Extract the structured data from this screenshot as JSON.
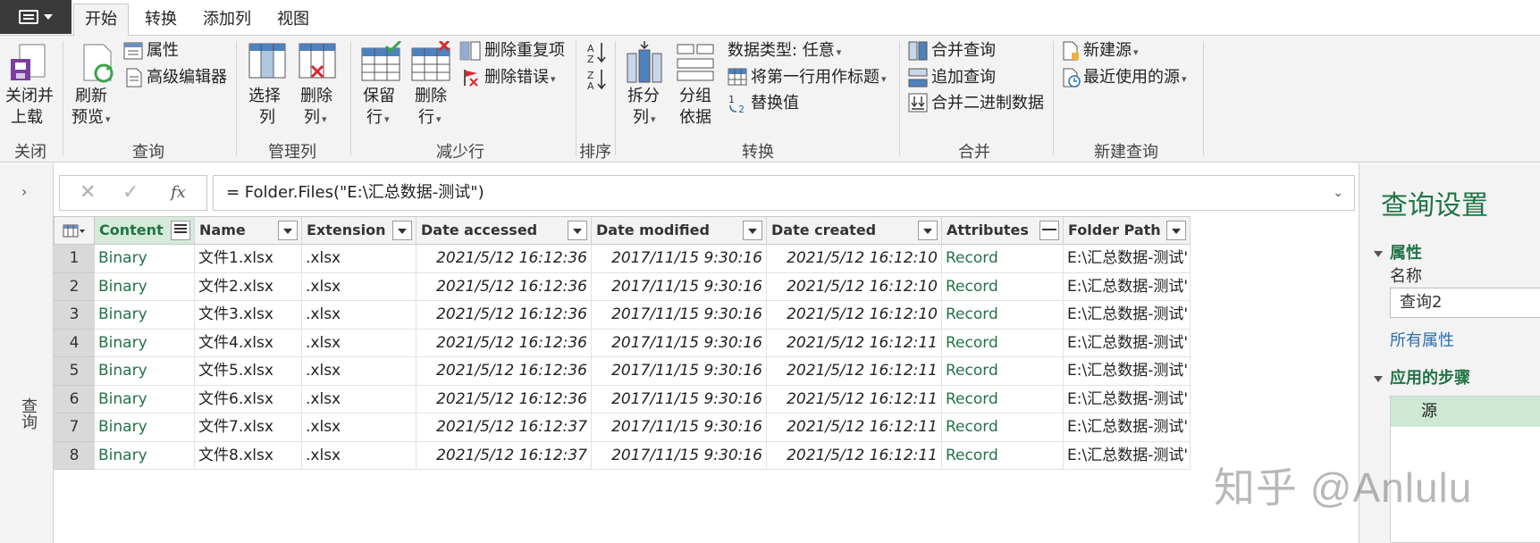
{
  "ribbon": {
    "tabs": [
      "开始",
      "转换",
      "添加列",
      "视图"
    ],
    "groups": {
      "close": {
        "label": "关闭",
        "close_load": [
          "关闭并",
          "上载"
        ]
      },
      "query": {
        "label": "查询",
        "refresh": [
          "刷新",
          "预览"
        ],
        "properties": "属性",
        "advanced_editor": "高级编辑器"
      },
      "manage_columns": {
        "label": "管理列",
        "choose": [
          "选择",
          "列"
        ],
        "remove": [
          "删除",
          "列"
        ]
      },
      "reduce_rows": {
        "label": "减少行",
        "keep": [
          "保留",
          "行"
        ],
        "remove": [
          "删除",
          "行"
        ],
        "remove_duplicates": "删除重复项",
        "remove_errors": "删除错误"
      },
      "sort": {
        "label": "排序"
      },
      "transform": {
        "label": "转换",
        "split": [
          "拆分",
          "列"
        ],
        "group": [
          "分组",
          "依据"
        ],
        "data_type": "数据类型: 任意",
        "first_row_header": "将第一行用作标题",
        "replace_values": "替换值"
      },
      "combine": {
        "label": "合并",
        "merge": "合并查询",
        "append": "追加查询",
        "combine_binary": "合并二进制数据"
      },
      "new_query": {
        "label": "新建查询",
        "new_source": "新建源",
        "recent_sources": "最近使用的源"
      }
    }
  },
  "queries_pane": {
    "label": "查询"
  },
  "formula_bar": {
    "expression": "= Folder.Files(\"E:\\汇总数据-测试\")"
  },
  "grid": {
    "columns": [
      "Content",
      "Name",
      "Extension",
      "Date accessed",
      "Date modified",
      "Date created",
      "Attributes",
      "Folder Path"
    ],
    "rows": [
      {
        "n": "1",
        "content": "Binary",
        "name": "文件1.xlsx",
        "ext": ".xlsx",
        "accessed": "2021/5/12 16:12:36",
        "modified": "2017/11/15 9:30:16",
        "created": "2021/5/12 16:12:10",
        "attributes": "Record",
        "path": "E:\\汇总数据-测试'"
      },
      {
        "n": "2",
        "content": "Binary",
        "name": "文件2.xlsx",
        "ext": ".xlsx",
        "accessed": "2021/5/12 16:12:36",
        "modified": "2017/11/15 9:30:16",
        "created": "2021/5/12 16:12:10",
        "attributes": "Record",
        "path": "E:\\汇总数据-测试'"
      },
      {
        "n": "3",
        "content": "Binary",
        "name": "文件3.xlsx",
        "ext": ".xlsx",
        "accessed": "2021/5/12 16:12:36",
        "modified": "2017/11/15 9:30:16",
        "created": "2021/5/12 16:12:10",
        "attributes": "Record",
        "path": "E:\\汇总数据-测试'"
      },
      {
        "n": "4",
        "content": "Binary",
        "name": "文件4.xlsx",
        "ext": ".xlsx",
        "accessed": "2021/5/12 16:12:36",
        "modified": "2017/11/15 9:30:16",
        "created": "2021/5/12 16:12:11",
        "attributes": "Record",
        "path": "E:\\汇总数据-测试'"
      },
      {
        "n": "5",
        "content": "Binary",
        "name": "文件5.xlsx",
        "ext": ".xlsx",
        "accessed": "2021/5/12 16:12:36",
        "modified": "2017/11/15 9:30:16",
        "created": "2021/5/12 16:12:11",
        "attributes": "Record",
        "path": "E:\\汇总数据-测试'"
      },
      {
        "n": "6",
        "content": "Binary",
        "name": "文件6.xlsx",
        "ext": ".xlsx",
        "accessed": "2021/5/12 16:12:36",
        "modified": "2017/11/15 9:30:16",
        "created": "2021/5/12 16:12:11",
        "attributes": "Record",
        "path": "E:\\汇总数据-测试'"
      },
      {
        "n": "7",
        "content": "Binary",
        "name": "文件7.xlsx",
        "ext": ".xlsx",
        "accessed": "2021/5/12 16:12:37",
        "modified": "2017/11/15 9:30:16",
        "created": "2021/5/12 16:12:11",
        "attributes": "Record",
        "path": "E:\\汇总数据-测试'"
      },
      {
        "n": "8",
        "content": "Binary",
        "name": "文件8.xlsx",
        "ext": ".xlsx",
        "accessed": "2021/5/12 16:12:37",
        "modified": "2017/11/15 9:30:16",
        "created": "2021/5/12 16:12:11",
        "attributes": "Record",
        "path": "E:\\汇总数据-测试'"
      }
    ]
  },
  "settings_pane": {
    "title": "查询设置",
    "properties_heading": "属性",
    "name_label": "名称",
    "name_value": "查询2",
    "all_properties_link": "所有属性",
    "applied_steps_heading": "应用的步骤",
    "steps": [
      "源"
    ]
  },
  "watermark": "知乎 @Anlulu",
  "colors": {
    "accent_green": "#217346",
    "selected_step": "#cde8d5",
    "ribbon_bg": "#f3f3f3"
  }
}
